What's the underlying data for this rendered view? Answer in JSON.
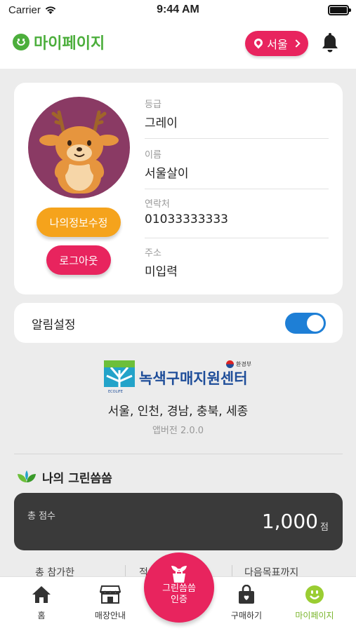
{
  "status_bar": {
    "carrier": "Carrier",
    "time": "9:44 AM"
  },
  "header": {
    "title": "마이페이지",
    "location": "서울",
    "icons": [
      "smile-icon",
      "pin-icon",
      "chevron-right-icon",
      "bell-icon"
    ]
  },
  "profile": {
    "edit_label": "나의정보수정",
    "logout_label": "로그아웃",
    "fields": [
      {
        "label": "등급",
        "value": "그레이"
      },
      {
        "label": "이름",
        "value": "서울살이"
      },
      {
        "label": "연락처",
        "value": "01033333333"
      },
      {
        "label": "주소",
        "value": "미입력"
      }
    ]
  },
  "notification": {
    "label": "알림설정",
    "enabled": true
  },
  "org": {
    "name": "녹색구매지원센터",
    "logo_caption": "ECOLIFE",
    "ministry": "환경부",
    "regions": "서울, 인천, 경남, 충북, 세종",
    "version": "앱버전 2.0.0"
  },
  "green": {
    "title": "나의 그린씀씀",
    "total_label": "총 점수",
    "total_value": "1,000",
    "total_unit": "점",
    "stats": [
      "총 참가한",
      "적",
      "다음목표까지"
    ]
  },
  "tabbar": {
    "items": [
      {
        "label": "홈",
        "icon": "home-icon"
      },
      {
        "label": "매장안내",
        "icon": "store-icon"
      },
      {
        "label": "구매하기",
        "icon": "shopping-bag-icon"
      },
      {
        "label": "마이페이지",
        "icon": "smile-icon"
      }
    ],
    "center": {
      "line1": "그린씀씀",
      "line2": "인증",
      "icon": "sprout-bag-icon"
    }
  },
  "colors": {
    "brand_green": "#4cae3c",
    "accent_pink": "#e8245e",
    "accent_orange": "#f5a31c",
    "toggle_blue": "#1e7fd6",
    "dark_card": "#3a3a3a"
  }
}
